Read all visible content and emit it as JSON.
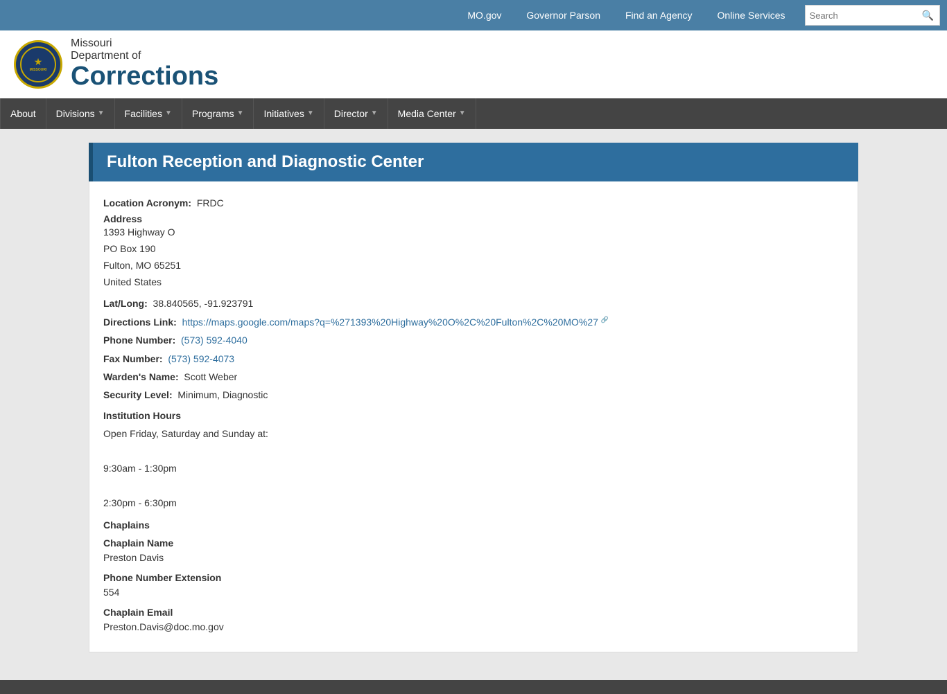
{
  "topbar": {
    "links": [
      {
        "label": "MO.gov",
        "href": "#"
      },
      {
        "label": "Governor Parson",
        "href": "#"
      },
      {
        "label": "Find an Agency",
        "href": "#"
      },
      {
        "label": "Online Services",
        "href": "#"
      }
    ],
    "search_placeholder": "Search"
  },
  "header": {
    "state": "Missouri",
    "dept_of": "Department of",
    "dept_name": "Corrections"
  },
  "nav": {
    "items": [
      {
        "label": "About",
        "has_arrow": false
      },
      {
        "label": "Divisions",
        "has_arrow": true
      },
      {
        "label": "Facilities",
        "has_arrow": true
      },
      {
        "label": "Programs",
        "has_arrow": true
      },
      {
        "label": "Initiatives",
        "has_arrow": true
      },
      {
        "label": "Director",
        "has_arrow": true
      },
      {
        "label": "Media Center",
        "has_arrow": true
      }
    ]
  },
  "page": {
    "title": "Fulton Reception and Diagnostic Center",
    "location_acronym_label": "Location Acronym:",
    "location_acronym": "FRDC",
    "address_label": "Address",
    "address_line1": "1393 Highway O",
    "address_line2": "PO Box 190",
    "address_line3": "Fulton, MO 65251",
    "address_line4": "United States",
    "lat_long_label": "Lat/Long:",
    "lat_long": "38.840565, -91.923791",
    "directions_label": "Directions Link:",
    "directions_url": "https://maps.google.com/maps?q=%271393%20Highway%20O%2C%20Fulton%2C%20MO%27",
    "directions_text": "https://maps.google.com/maps?q=%271393%20Highway%20O%2C%20Fulton%2C%20MO%27",
    "phone_label": "Phone Number:",
    "phone": "(573) 592-4040",
    "fax_label": "Fax Number:",
    "fax": "(573) 592-4073",
    "warden_label": "Warden's Name:",
    "warden": "Scott Weber",
    "security_label": "Security Level:",
    "security": "Minimum, Diagnostic",
    "hours_heading": "Institution Hours",
    "hours_intro": "Open Friday, Saturday and Sunday at:",
    "hours_slot1": "9:30am - 1:30pm",
    "hours_slot2": "2:30pm - 6:30pm",
    "chaplains_heading": "Chaplains",
    "chaplain_name_label": "Chaplain Name",
    "chaplain_name": "Preston Davis",
    "phone_ext_label": "Phone Number Extension",
    "phone_ext": "554",
    "chaplain_email_label": "Chaplain Email",
    "chaplain_email": "Preston.Davis@doc.mo.gov"
  }
}
